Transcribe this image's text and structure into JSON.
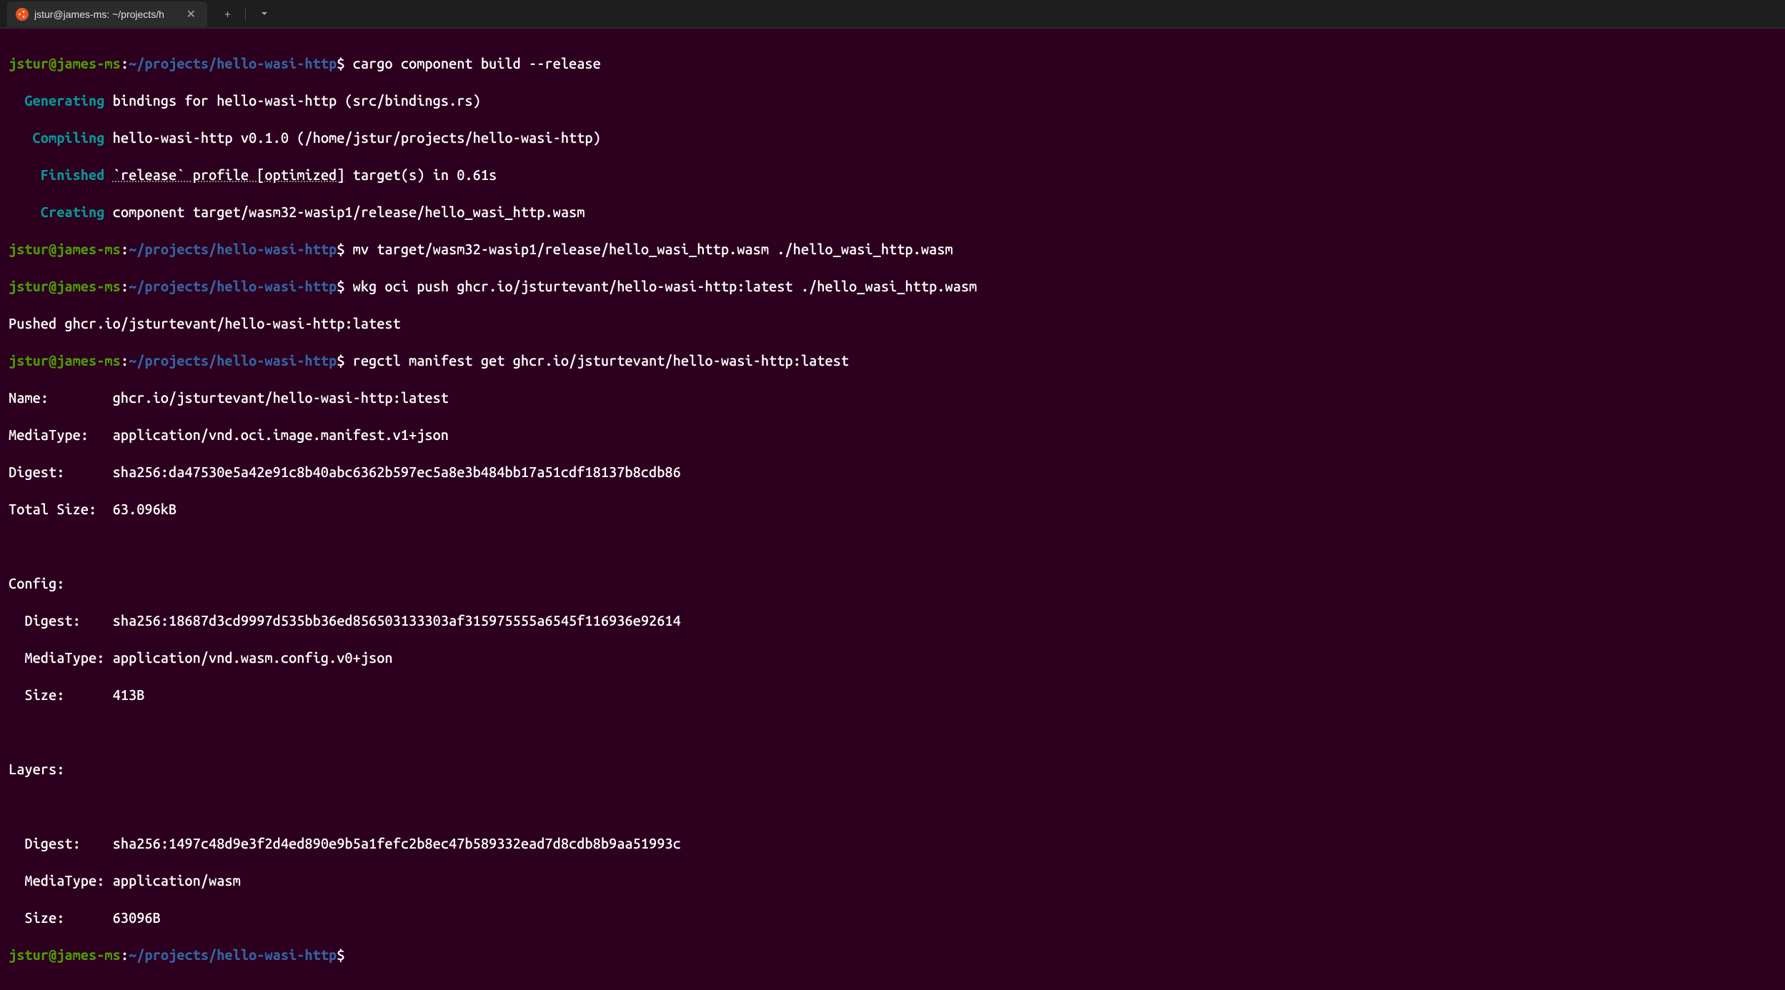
{
  "titlebar": {
    "tab_title": "jstur@james-ms: ~/projects/h"
  },
  "prompt": {
    "user_host": "jstur@james-ms",
    "path": "~/projects/hello-wasi-http",
    "symbol": "$"
  },
  "commands": {
    "cmd1": "cargo component build --release",
    "cmd2": "mv target/wasm32-wasip1/release/hello_wasi_http.wasm ./hello_wasi_http.wasm",
    "cmd3": "wkg oci push ghcr.io/jsturtevant/hello-wasi-http:latest ./hello_wasi_http.wasm",
    "cmd4": "regctl manifest get ghcr.io/jsturtevant/hello-wasi-http:latest"
  },
  "build_output": {
    "generating_label": "Generating",
    "generating_text": " bindings for hello-wasi-http (src/bindings.rs)",
    "compiling_label": "Compiling",
    "compiling_text": " hello-wasi-http v0.1.0 (/home/jstur/projects/hello-wasi-http)",
    "finished_label": "Finished",
    "finished_underline": "`release` profile [optimized]",
    "finished_text": " target(s) in 0.61s",
    "creating_label": "Creating",
    "creating_text": " component target/wasm32-wasip1/release/hello_wasi_http.wasm"
  },
  "push_output": {
    "pushed": "Pushed ghcr.io/jsturtevant/hello-wasi-http:latest"
  },
  "manifest": {
    "name_label": "Name:",
    "name_value": "ghcr.io/jsturtevant/hello-wasi-http:latest",
    "mediatype_label": "MediaType:",
    "mediatype_value": "application/vnd.oci.image.manifest.v1+json",
    "digest_label": "Digest:",
    "digest_value": "sha256:da47530e5a42e91c8b40abc6362b597ec5a8e3b484bb17a51cdf18137b8cdb86",
    "totalsize_label": "Total Size:",
    "totalsize_value": "63.096kB",
    "config_header": "Config:",
    "config_digest_label": "Digest:",
    "config_digest_value": "sha256:18687d3cd9997d535bb36ed856503133303af315975555a6545f116936e92614",
    "config_mediatype_label": "MediaType:",
    "config_mediatype_value": "application/vnd.wasm.config.v0+json",
    "config_size_label": "Size:",
    "config_size_value": "413B",
    "layers_header": "Layers:",
    "layer_digest_label": "Digest:",
    "layer_digest_value": "sha256:1497c48d9e3f2d4ed890e9b5a1fefc2b8ec47b589332ead7d8cdb8b9aa51993c",
    "layer_mediatype_label": "MediaType:",
    "layer_mediatype_value": "application/wasm",
    "layer_size_label": "Size:",
    "layer_size_value": "63096B"
  }
}
